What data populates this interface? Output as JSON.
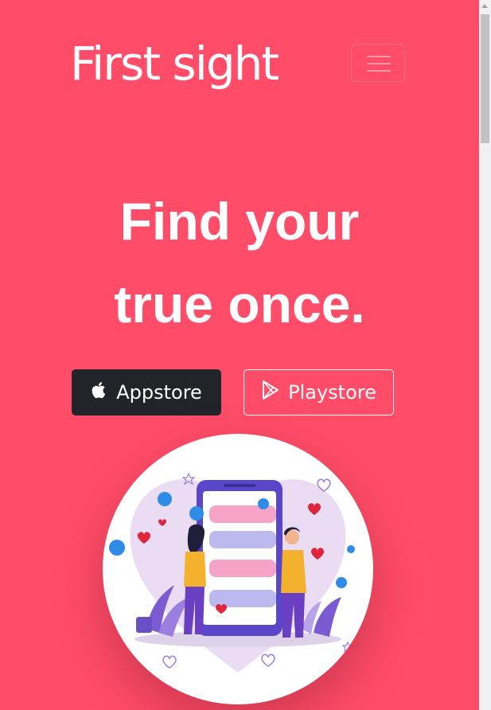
{
  "navbar": {
    "brand": "First sight",
    "toggler_icon": "hamburger-menu-icon"
  },
  "hero": {
    "headline_line1": "Find your",
    "headline_line2": "true once.",
    "buttons": {
      "appstore_label": "Appstore",
      "appstore_icon": "apple-icon",
      "playstore_label": "Playstore",
      "playstore_icon": "play-store-icon"
    },
    "illustration": "couple-chatting-on-phone-illustration"
  },
  "colors": {
    "background": "#ff4c68",
    "dark_button": "#212529",
    "text": "#ffffff"
  }
}
